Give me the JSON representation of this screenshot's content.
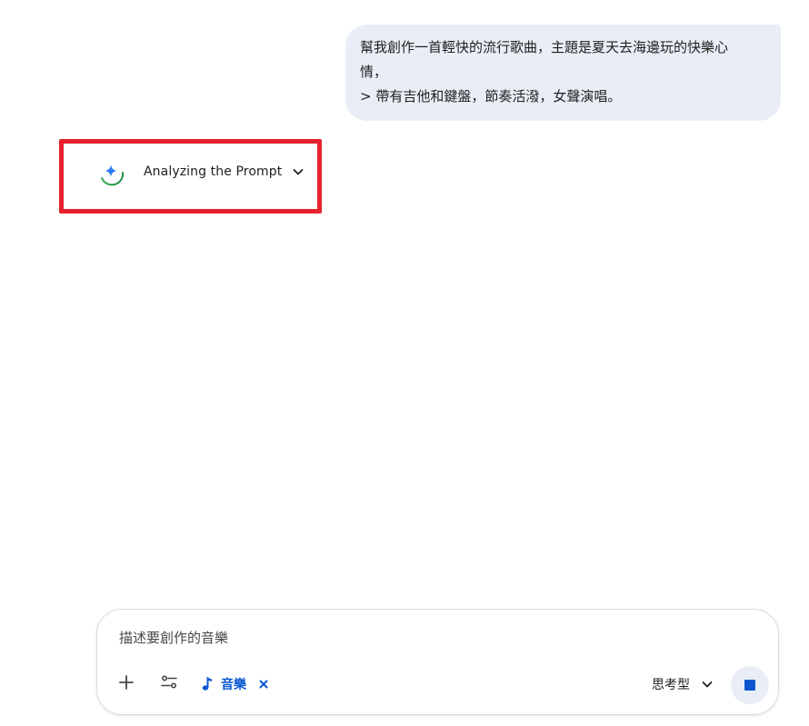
{
  "conversation": {
    "user_message": {
      "line1": "幫我創作一首輕快的流行歌曲，主題是夏天去海邊玩的快樂心",
      "line2": "情，",
      "line3": "> 帶有吉他和鍵盤，節奏活潑，女聲演唱。"
    },
    "status": {
      "label": "Analyzing the Prompt",
      "icon": "sparkle-icon",
      "expand_icon": "chevron-down-icon"
    }
  },
  "composer": {
    "placeholder": "描述要創作的音樂",
    "value": "",
    "add_icon": "plus-icon",
    "tools_icon": "sliders-icon",
    "music_chip": {
      "label": "音樂",
      "icon": "music-note-icon",
      "remove_icon": "close-icon"
    },
    "mode": {
      "label": "思考型",
      "icon": "chevron-down-icon"
    },
    "stop_icon": "stop-icon"
  },
  "colors": {
    "accent": "#0b57d0",
    "bubble": "#e9eef6",
    "highlight": "#e8212e"
  }
}
